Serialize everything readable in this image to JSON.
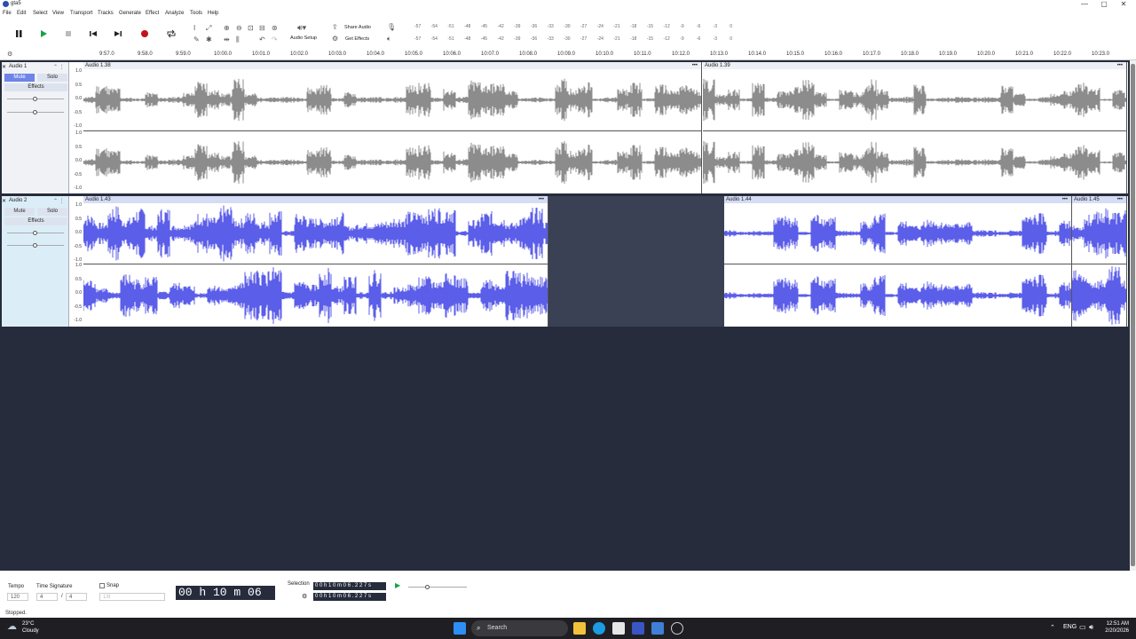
{
  "window": {
    "title": "gta5",
    "controls": [
      "—",
      "▢",
      "✕"
    ]
  },
  "menu": [
    "File",
    "Edit",
    "Select",
    "View",
    "Transport",
    "Tracks",
    "Generate",
    "Effect",
    "Analyze",
    "Tools",
    "Help"
  ],
  "toolbar": {
    "audio_setup": "Audio Setup",
    "share_audio": "Share Audio",
    "get_effects": "Get Effects"
  },
  "meter": {
    "ticks": [
      "-57",
      "-54",
      "-51",
      "-48",
      "-45",
      "-42",
      "-39",
      "-36",
      "-33",
      "-30",
      "-27",
      "-24",
      "-21",
      "-18",
      "-15",
      "-12",
      "-9",
      "-6",
      "-3",
      "0"
    ],
    "ticks2": [
      "-57",
      "-54",
      "-51",
      "-48",
      "-45",
      "-42",
      "-39",
      "-36",
      "-33",
      "-30",
      "-27",
      "-24",
      "-21",
      "-18",
      "-15",
      "-12",
      "-9",
      "-6",
      "-3",
      "0"
    ],
    "l": "L",
    "r": "R"
  },
  "ruler": [
    "9:57.0",
    "9:58.0",
    "9:59.0",
    "10:00.0",
    "10:01.0",
    "10:02.0",
    "10:03.0",
    "10:04.0",
    "10:05.0",
    "10:06.0",
    "10:07.0",
    "10:08.0",
    "10:09.0",
    "10:10.0",
    "10:11.0",
    "10:12.0",
    "10:13.0",
    "10:14.0",
    "10:15.0",
    "10:16.0",
    "10:17.0",
    "10:18.0",
    "10:19.0",
    "10:20.0",
    "10:21.0",
    "10:22.0",
    "10:23.0"
  ],
  "scale": [
    "1.0",
    "0.5",
    "0.0",
    "-0.5",
    "-1.0"
  ],
  "tracks": [
    {
      "name": "Audio 1",
      "mute": "Mute",
      "solo": "Solo",
      "effects": "Effects",
      "clips": [
        {
          "name": "Audio 1.38",
          "menu": "•••"
        },
        {
          "name": "Audio 1.39",
          "menu": "•••"
        }
      ]
    },
    {
      "name": "Audio 2",
      "mute": "Mute",
      "solo": "Solo",
      "effects": "Effects",
      "clips": [
        {
          "name": "Audio 1.43",
          "menu": "•••"
        },
        {
          "name": "Audio 1.44",
          "menu": "•••"
        },
        {
          "name": "Audio 1.45",
          "menu": "•••"
        }
      ]
    }
  ],
  "bottom": {
    "tempo_label": "Tempo",
    "tempo_value": "120",
    "timesig_label": "Time Signature",
    "timesig_num": "4",
    "timesig_sep": "/",
    "timesig_den": "4",
    "snap_label": "Snap",
    "snap_value": "1/8",
    "time": "00 h 10 m 06 s",
    "selection_label": "Selection",
    "sel_start": "0 0 h 1 0 m 0 6 . 2 2 7 s",
    "sel_end": "0 0 h 1 0 m 0 6 . 2 2 7 s"
  },
  "status": "Stopped.",
  "taskbar": {
    "temp": "23°C",
    "weather": "Cloudy",
    "search": "Search",
    "time": "12:51 AM",
    "date": "2/20/2026"
  },
  "colors": {
    "track1_wave": "#8c8c8c",
    "track2_wave": "#5b5ee8",
    "workspace": "#262c3c"
  }
}
